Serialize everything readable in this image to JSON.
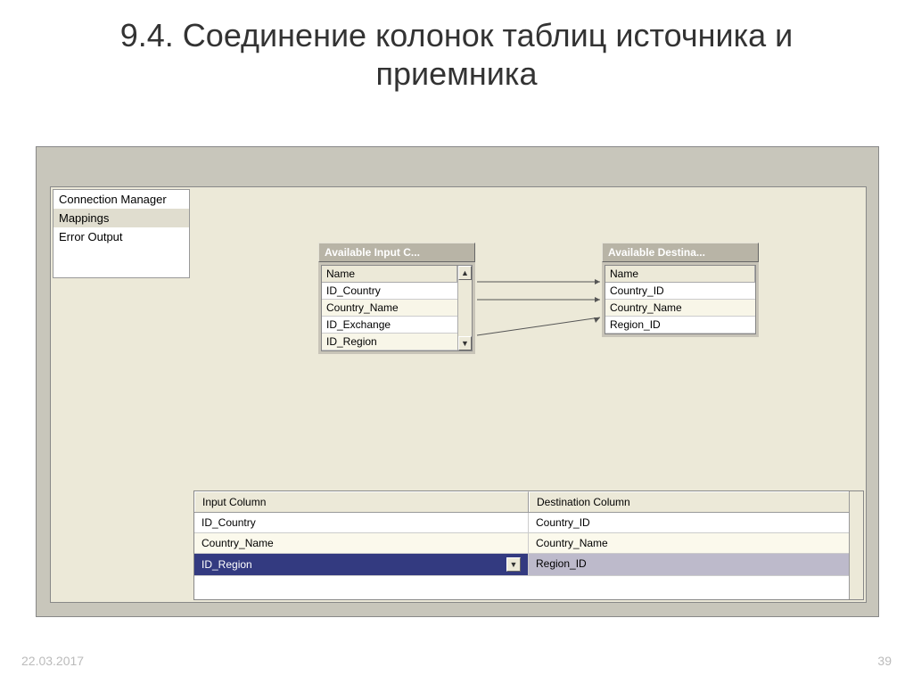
{
  "slide": {
    "title": "9.4. Соединение колонок таблиц источника и приемника",
    "date": "22.03.2017",
    "page": "39"
  },
  "sidebar": {
    "items": [
      {
        "label": "Connection Manager",
        "selected": false
      },
      {
        "label": "Mappings",
        "selected": true
      },
      {
        "label": "Error Output",
        "selected": false
      }
    ]
  },
  "input_box": {
    "title": "Available Input C...",
    "header": "Name",
    "rows": [
      "ID_Country",
      "Country_Name",
      "ID_Exchange",
      "ID_Region"
    ]
  },
  "dest_box": {
    "title": "Available Destina...",
    "header": "Name",
    "rows": [
      "Country_ID",
      "Country_Name",
      "Region_ID"
    ]
  },
  "grid": {
    "headers": [
      "Input Column",
      "Destination Column"
    ],
    "rows": [
      {
        "input": "ID_Country",
        "dest": "Country_ID"
      },
      {
        "input": "Country_Name",
        "dest": "Country_Name"
      },
      {
        "input": "ID_Region",
        "dest": "Region_ID"
      }
    ]
  },
  "glyphs": {
    "up": "▲",
    "down": "▼"
  }
}
